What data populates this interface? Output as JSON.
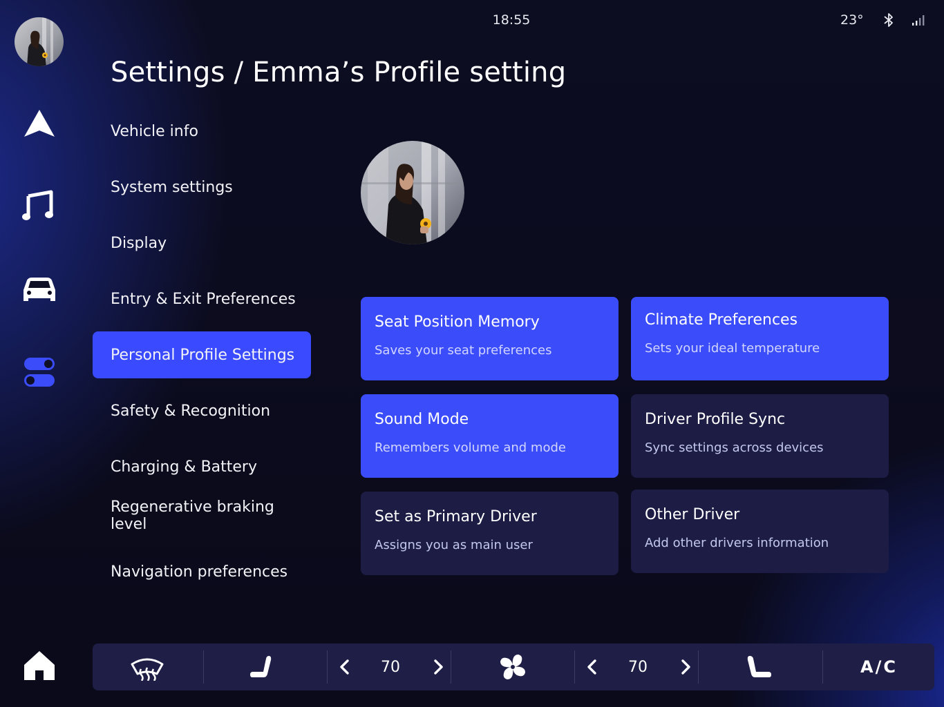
{
  "status_bar": {
    "time": "18:55",
    "temperature": "23°",
    "icons": [
      "bluetooth-icon",
      "signal-icon"
    ]
  },
  "rail": {
    "icons": [
      "profile-avatar",
      "navigation-icon",
      "music-icon",
      "car-icon",
      "settings-toggle-icon",
      "home-icon"
    ]
  },
  "page": {
    "title": "Settings / Emma’s Profile setting"
  },
  "menu": {
    "items": [
      {
        "label": "Vehicle info"
      },
      {
        "label": "System settings"
      },
      {
        "label": "Display"
      },
      {
        "label": "Entry & Exit Preferences"
      },
      {
        "label": "Personal Profile Settings",
        "active": true
      },
      {
        "label": "Safety & Recognition"
      },
      {
        "label": "Charging & Battery"
      },
      {
        "label": "Regenerative braking level"
      },
      {
        "label": "Navigation preferences"
      }
    ]
  },
  "cards": [
    {
      "title": "Seat Position Memory",
      "subtitle": "Saves your seat preferences",
      "enabled": true
    },
    {
      "title": "Climate Preferences",
      "subtitle": "Sets your ideal temperature",
      "enabled": true
    },
    {
      "title": "Sound Mode",
      "subtitle": "Remembers volume and mode",
      "enabled": true
    },
    {
      "title": "Driver Profile Sync",
      "subtitle": "Sync settings across devices",
      "enabled": false
    },
    {
      "title": "Set as Primary Driver",
      "subtitle": "Assigns you as main user",
      "enabled": false
    },
    {
      "title": "Other Driver",
      "subtitle": "Add other drivers information",
      "enabled": false
    }
  ],
  "climate": {
    "left_temp": "70",
    "right_temp": "70",
    "ac_label": "A/C",
    "icons": [
      "rear-defrost-icon",
      "driver-seat-icon",
      "fan-icon",
      "passenger-seat-icon"
    ]
  },
  "colors": {
    "accent": "#3b4cfb",
    "card_inactive": "#1c1c44",
    "background": "#0b0b1c"
  }
}
